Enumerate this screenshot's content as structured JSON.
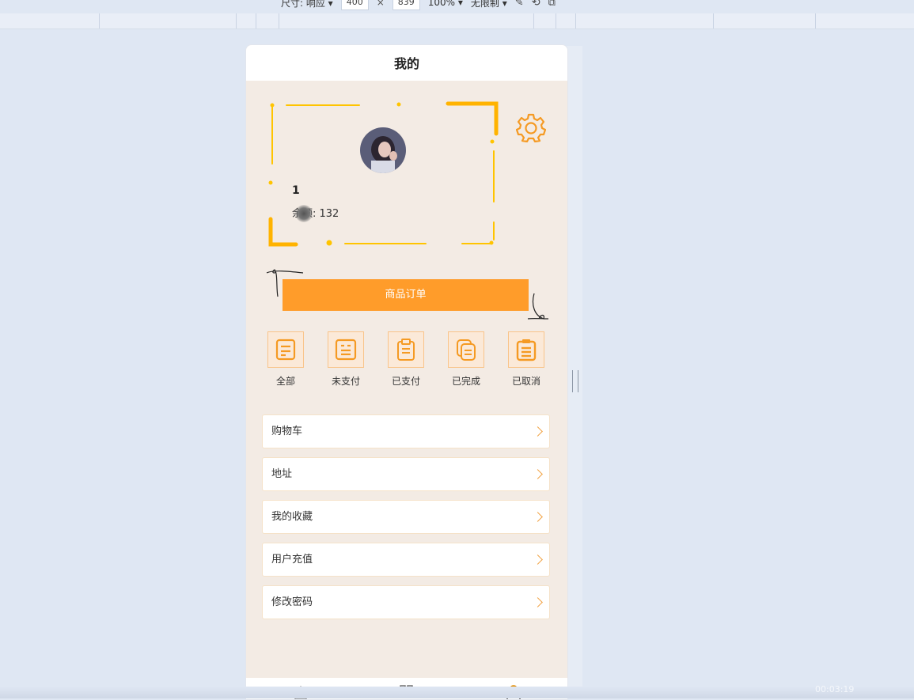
{
  "devtools": {
    "size_label": "尺寸: 响应",
    "width": "400",
    "times": "×",
    "height": "839",
    "zoom": "100%",
    "throttle": "无限制"
  },
  "header": {
    "title": "我的"
  },
  "profile": {
    "username": "1",
    "balance_label": "余额: 132"
  },
  "order_button": {
    "label": "商品订单"
  },
  "order_status": [
    {
      "label": "全部",
      "icon": "document-icon"
    },
    {
      "label": "未支付",
      "icon": "receipt-icon"
    },
    {
      "label": "已支付",
      "icon": "clipboard-icon"
    },
    {
      "label": "已完成",
      "icon": "copy-document-icon"
    },
    {
      "label": "已取消",
      "icon": "list-clipboard-icon"
    }
  ],
  "menu": [
    {
      "label": "购物车"
    },
    {
      "label": "地址"
    },
    {
      "label": "我的收藏"
    },
    {
      "label": "用户充值"
    },
    {
      "label": "修改密码"
    }
  ],
  "bottom_nav": [
    {
      "icon": "home-icon"
    },
    {
      "icon": "category-grid-icon"
    },
    {
      "icon": "user-icon",
      "active": true
    }
  ],
  "clock": "00:03:19",
  "colors": {
    "accent": "#ff9c2a",
    "page_bg": "#f3ebe4",
    "icon_bg": "#fbe9d8",
    "gold": "#ffc400"
  }
}
